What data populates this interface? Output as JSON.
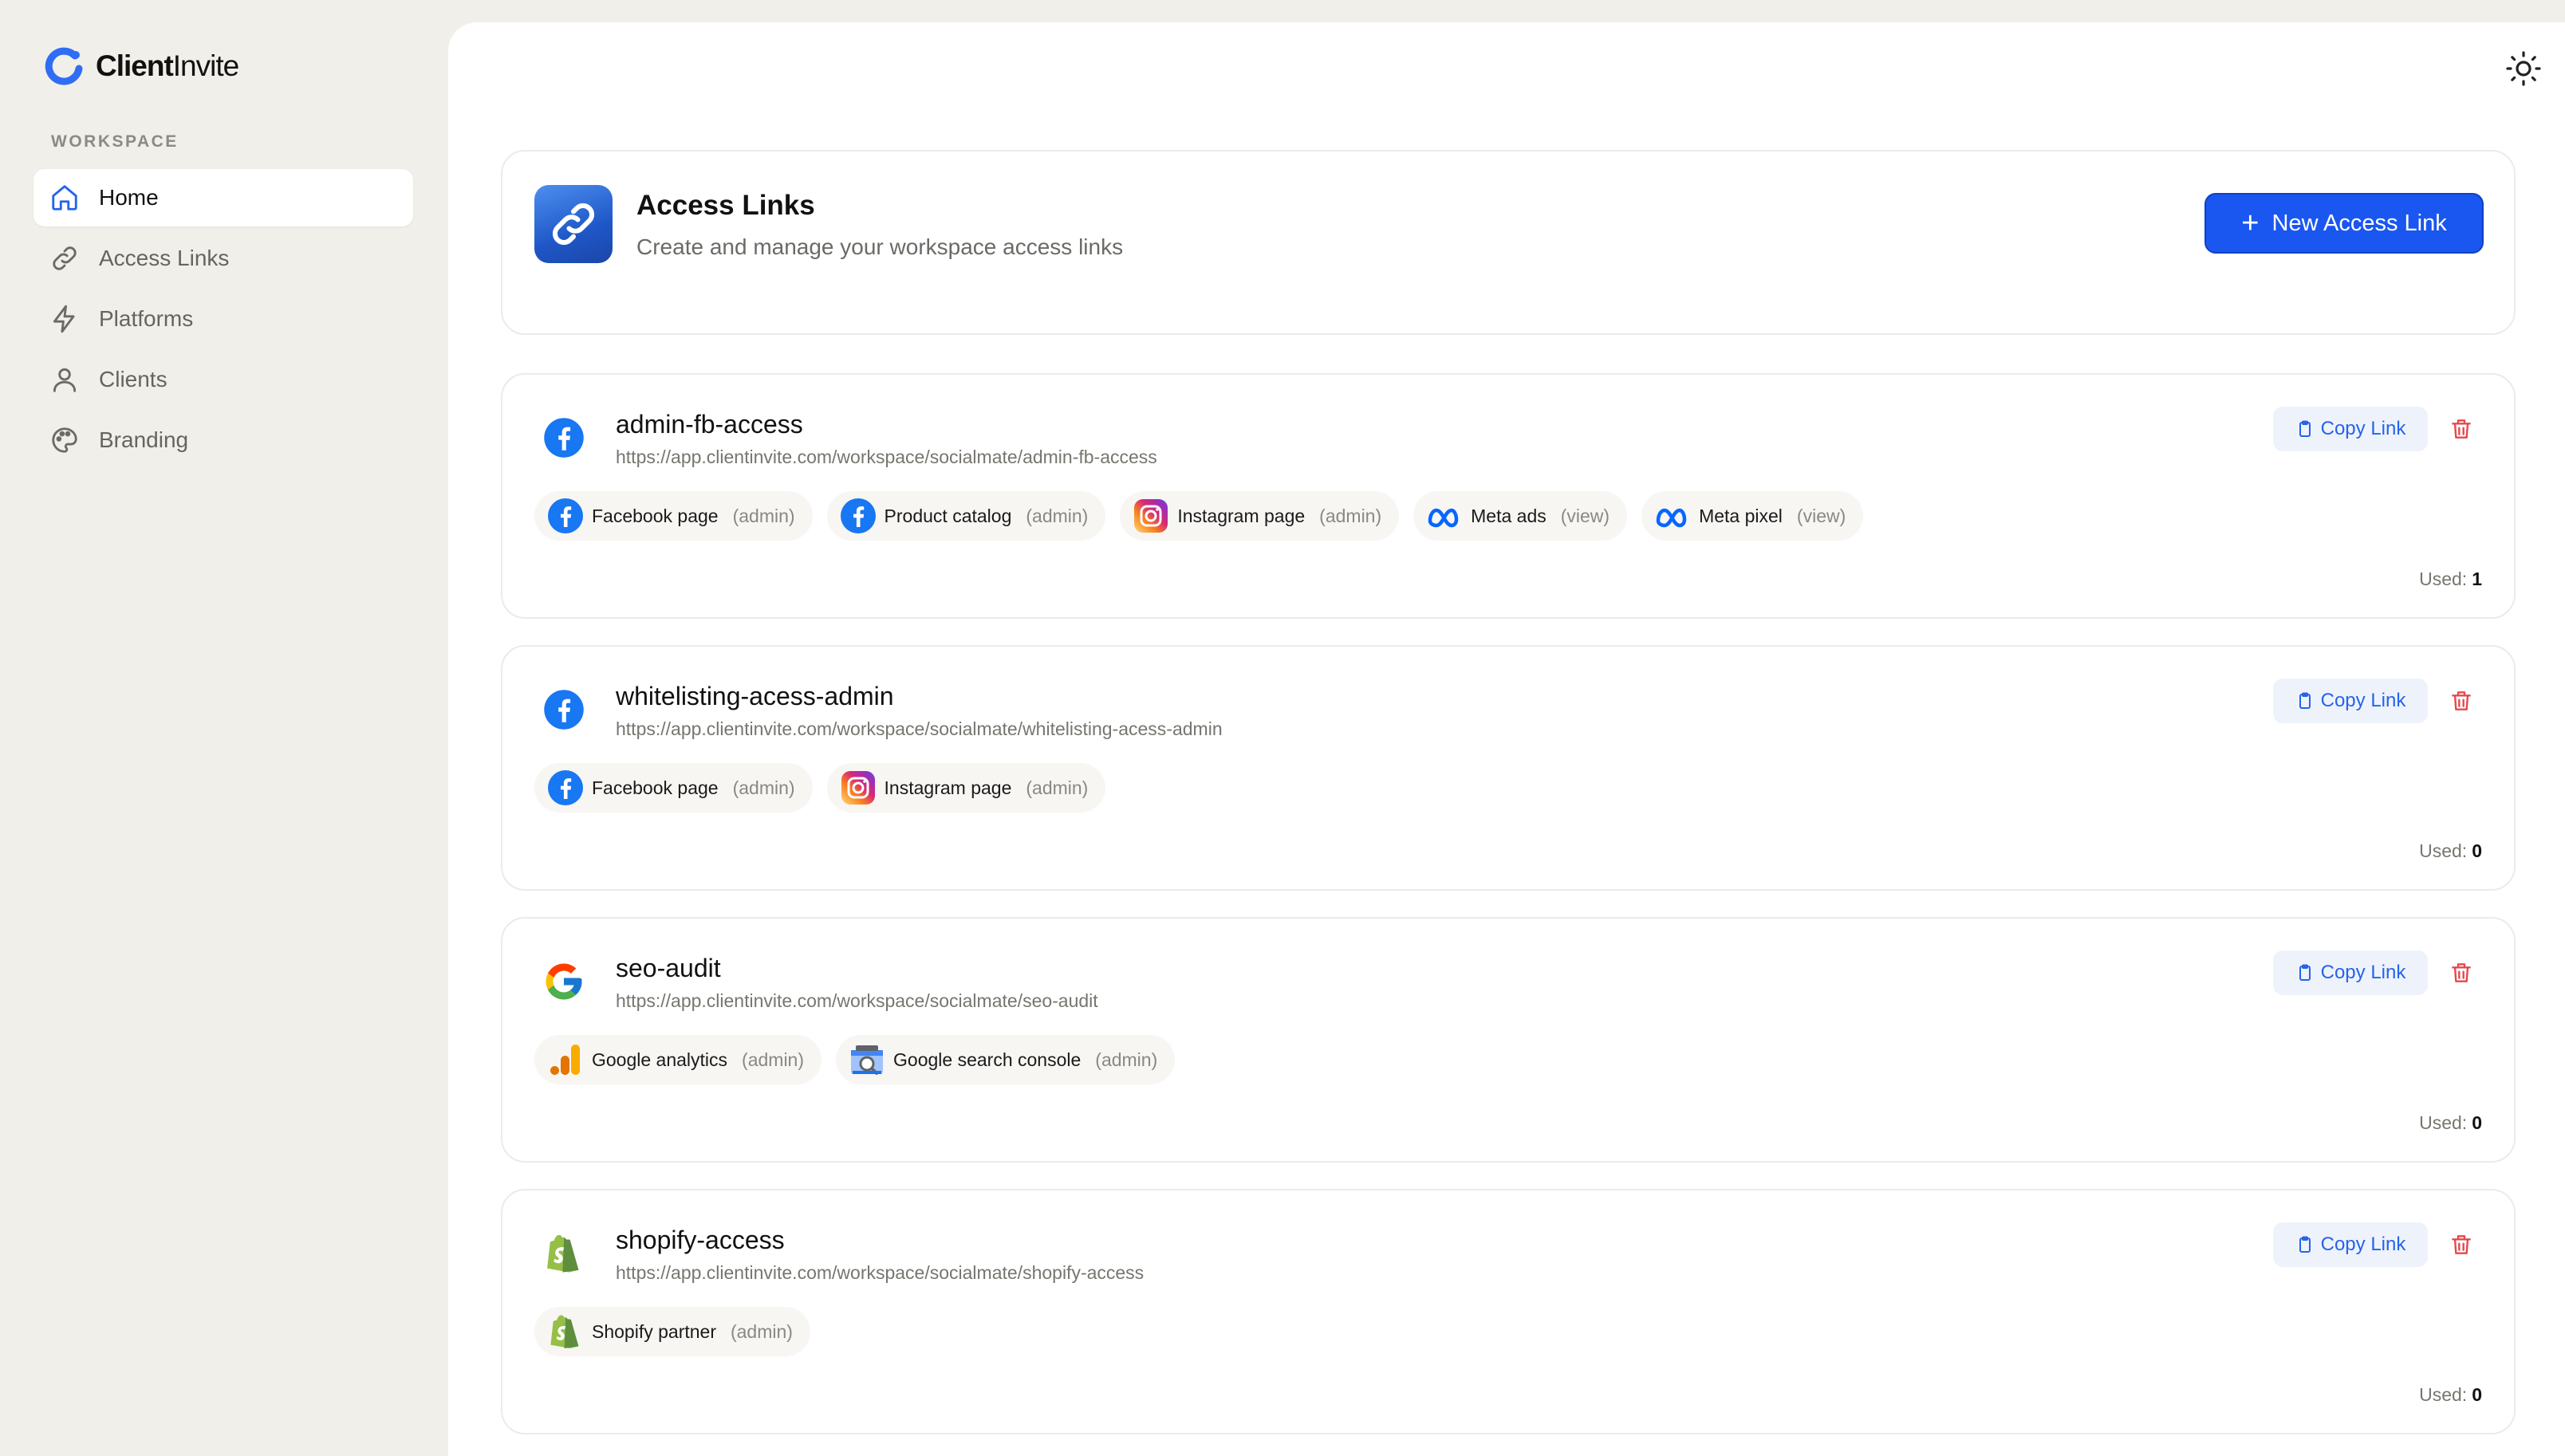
{
  "app": {
    "logo_strong": "Client",
    "logo_rest": "Invite"
  },
  "sidebar": {
    "section_label": "WORKSPACE",
    "items": [
      {
        "label": "Home",
        "icon": "home-icon",
        "active": true
      },
      {
        "label": "Access Links",
        "icon": "link-icon"
      },
      {
        "label": "Platforms",
        "icon": "bolt-icon"
      },
      {
        "label": "Clients",
        "icon": "user-icon"
      },
      {
        "label": "Branding",
        "icon": "palette-icon"
      }
    ]
  },
  "header": {
    "title": "Access Links",
    "subtitle": "Create and manage your workspace access links",
    "new_button": "New Access Link"
  },
  "colors": {
    "accent": "#1a56f0",
    "delete": "#e5484d",
    "sidebar_bg": "#f1efe9"
  },
  "links": [
    {
      "name": "admin-fb-access",
      "url": "https://app.clientinvite.com/workspace/socialmate/admin-fb-access",
      "icon": "facebook-icon",
      "copy_label": "Copy Link",
      "used_label": "Used:",
      "used": "1",
      "platforms": [
        {
          "name": "Facebook page",
          "role": "(admin)",
          "icon": "facebook-icon"
        },
        {
          "name": "Product catalog",
          "role": "(admin)",
          "icon": "facebook-icon"
        },
        {
          "name": "Instagram page",
          "role": "(admin)",
          "icon": "instagram-icon"
        },
        {
          "name": "Meta ads",
          "role": "(view)",
          "icon": "meta-icon"
        },
        {
          "name": "Meta pixel",
          "role": "(view)",
          "icon": "meta-icon"
        }
      ]
    },
    {
      "name": "whitelisting-acess-admin",
      "url": "https://app.clientinvite.com/workspace/socialmate/whitelisting-acess-admin",
      "icon": "facebook-icon",
      "copy_label": "Copy Link",
      "used_label": "Used:",
      "used": "0",
      "platforms": [
        {
          "name": "Facebook page",
          "role": "(admin)",
          "icon": "facebook-icon"
        },
        {
          "name": "Instagram page",
          "role": "(admin)",
          "icon": "instagram-icon"
        }
      ]
    },
    {
      "name": "seo-audit",
      "url": "https://app.clientinvite.com/workspace/socialmate/seo-audit",
      "icon": "google-icon",
      "copy_label": "Copy Link",
      "used_label": "Used:",
      "used": "0",
      "platforms": [
        {
          "name": "Google analytics",
          "role": "(admin)",
          "icon": "google-analytics-icon"
        },
        {
          "name": "Google search console",
          "role": "(admin)",
          "icon": "search-console-icon"
        }
      ]
    },
    {
      "name": "shopify-access",
      "url": "https://app.clientinvite.com/workspace/socialmate/shopify-access",
      "icon": "shopify-icon",
      "copy_label": "Copy Link",
      "used_label": "Used:",
      "used": "0",
      "platforms": [
        {
          "name": "Shopify partner",
          "role": "(admin)",
          "icon": "shopify-icon"
        }
      ]
    }
  ]
}
